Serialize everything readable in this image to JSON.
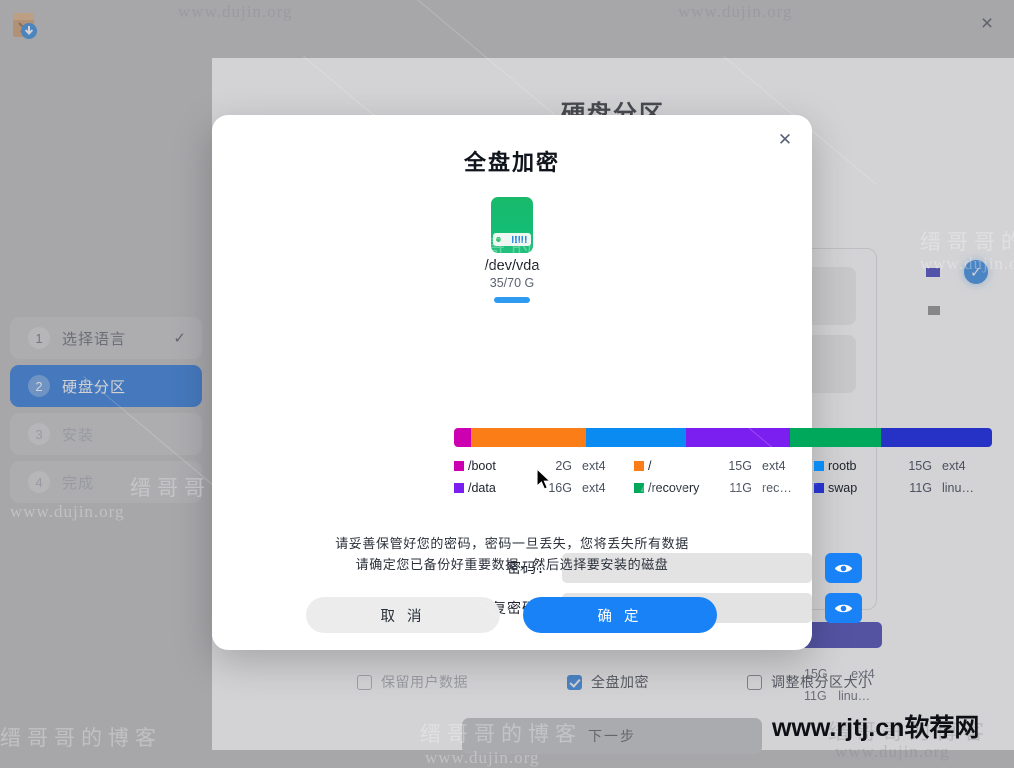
{
  "window": {
    "app_icon": "package-download-icon",
    "close_label": "×"
  },
  "background": {
    "page_title": "硬盘分区",
    "steps": [
      {
        "num": "1",
        "label": "选择语言",
        "state": "done",
        "tick": "✓"
      },
      {
        "num": "2",
        "label": "硬盘分区",
        "state": "active",
        "tick": ""
      },
      {
        "num": "3",
        "label": "安装",
        "state": "dim",
        "tick": ""
      },
      {
        "num": "4",
        "label": "完成",
        "state": "dim",
        "tick": ""
      }
    ],
    "options": [
      {
        "label": "保留用户数据",
        "checked": false,
        "dim": true
      },
      {
        "label": "全盘加密",
        "checked": true,
        "dim": false
      },
      {
        "label": "调整根分区大小",
        "checked": false,
        "dim": false
      }
    ],
    "next_button": "下一步",
    "disk_card_check": "✓",
    "legend_tail": [
      {
        "size": "15G",
        "fs": "ext4"
      },
      {
        "size": "11G",
        "fs": "linu…"
      }
    ]
  },
  "dialog": {
    "title": "全盘加密",
    "close_label": "✕",
    "disk": {
      "icon": "hard-disk-icon",
      "name": "/dev/vda",
      "size": "35/70 G"
    },
    "partition_bar": [
      {
        "color": "#cc00b0",
        "pct": 3.2
      },
      {
        "color": "#fb7d18",
        "pct": 21.3
      },
      {
        "color": "#0a8bf2",
        "pct": 18.6
      },
      {
        "color": "#7b1ff0",
        "pct": 19.3
      },
      {
        "color": "#00a85b",
        "pct": 16.9
      },
      {
        "color": "#2631c6",
        "pct": 20.7
      }
    ],
    "legend": [
      {
        "color": "#cc00b0",
        "name": "/boot",
        "size": "2G",
        "fs": "ext4"
      },
      {
        "color": "#fb7d18",
        "name": "/",
        "size": "15G",
        "fs": "ext4"
      },
      {
        "color": "#0a8bf2",
        "name": "rootb",
        "size": "15G",
        "fs": "ext4"
      },
      {
        "color": "#7b1ff0",
        "name": "/data",
        "size": "16G",
        "fs": "ext4"
      },
      {
        "color": "#00a85b",
        "name": "/recovery",
        "size": "11G",
        "fs": "rec…"
      },
      {
        "color": "#2631c6",
        "name": "swap",
        "size": "11G",
        "fs": "linu…"
      }
    ],
    "fields": [
      {
        "label": "密码：",
        "value": "",
        "placeholder": "",
        "eye": "eye-icon"
      },
      {
        "label": "重复密码：",
        "value": "",
        "placeholder": "",
        "eye": "eye-icon"
      }
    ],
    "warning_line1": "请妥善保管好您的密码，密码一旦丢失，您将丢失所有数据",
    "warning_line2": "请确定您已备份好重要数据，然后选择要安装的磁盘",
    "cancel_button": "取 消",
    "ok_button": "确 定"
  },
  "watermarks": {
    "site_cn": "缙哥哥的博客",
    "site_url": "www.dujin.org",
    "bottom_right": "www.rjtj.cn软荐网"
  },
  "colors": {
    "accent_blue": "#1a82f7",
    "active_step": "#0b62d4",
    "disk_green": "#14bd74",
    "window_bg": "#b4b4b6"
  }
}
